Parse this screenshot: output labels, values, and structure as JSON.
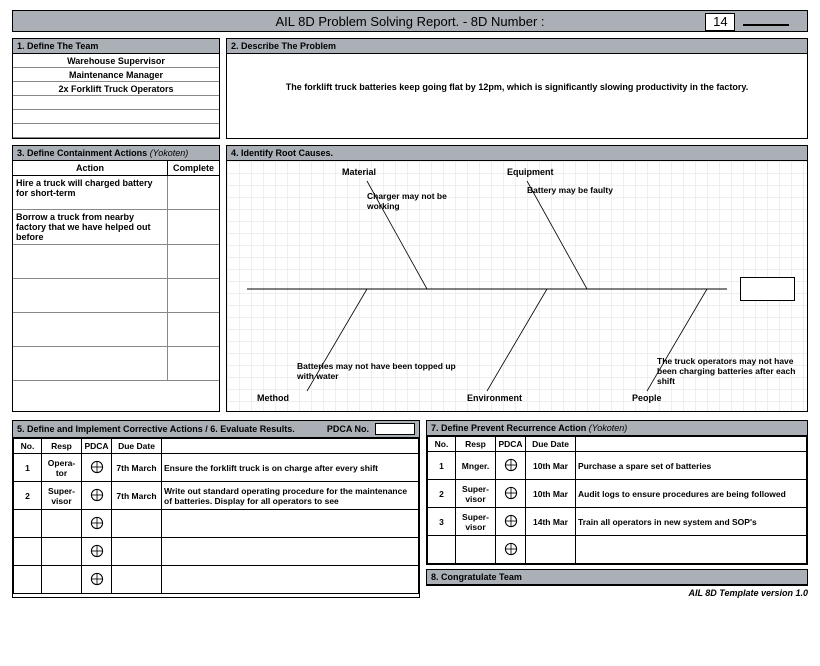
{
  "title": "AIL 8D Problem Solving Report.  -  8D Number :",
  "report_number": "14",
  "sections": {
    "s1": {
      "heading": "1. Define The Team"
    },
    "s2": {
      "heading": "2. Describe The Problem"
    },
    "s3": {
      "heading": "3. Define Containment Actions ",
      "heading_ital": "(Yokoten)"
    },
    "s4": {
      "heading": "4. Identify Root Causes."
    },
    "s5": {
      "heading": "5. Define and Implement Corrective Actions /  6. Evaluate Results."
    },
    "s7": {
      "heading": "7. Define Prevent Recurrence Action ",
      "heading_ital": "(Yokoten)"
    },
    "s8": {
      "heading": "8. Congratulate Team"
    }
  },
  "team": [
    "Warehouse Supervisor",
    "Maintenance Manager",
    "2x Forklift Truck Operators",
    "",
    "",
    ""
  ],
  "problem_description": "The forklift truck batteries keep going flat by 12pm, which is significantly slowing productivity in the factory.",
  "containment": {
    "cols": {
      "action": "Action",
      "complete": "Complete"
    },
    "rows": [
      {
        "action": "Hire a truck will charged battery for short-term",
        "complete": ""
      },
      {
        "action": "Borrow a truck from nearby factory that we have helped out before",
        "complete": ""
      },
      {
        "action": "",
        "complete": ""
      },
      {
        "action": "",
        "complete": ""
      },
      {
        "action": "",
        "complete": ""
      },
      {
        "action": "",
        "complete": ""
      }
    ]
  },
  "fishbone": {
    "categories": {
      "material": "Material",
      "equipment": "Equipment",
      "method": "Method",
      "environment": "Environment",
      "people": "People"
    },
    "causes": {
      "material": "Charger may not be working",
      "equipment": "Battery may be faulty",
      "method": "Batteries may not have been topped up with water",
      "environment": "",
      "people": "The truck operators may not have been charging batteries after each shift"
    }
  },
  "corrective": {
    "pdca_label": "PDCA No.",
    "cols": {
      "no": "No.",
      "resp": "Resp",
      "pdca": "PDCA",
      "due": "Due Date"
    },
    "rows": [
      {
        "no": "1",
        "resp": "Opera-tor",
        "due": "7th March",
        "desc": "Ensure the forklift truck is on charge after every shift"
      },
      {
        "no": "2",
        "resp": "Super-visor",
        "due": "7th March",
        "desc": "Write out standard operating procedure for the maintenance of batteries.  Display for all operators to see"
      },
      {
        "no": "",
        "resp": "",
        "due": "",
        "desc": ""
      },
      {
        "no": "",
        "resp": "",
        "due": "",
        "desc": ""
      },
      {
        "no": "",
        "resp": "",
        "due": "",
        "desc": ""
      }
    ]
  },
  "prevent": {
    "cols": {
      "no": "No.",
      "resp": "Resp",
      "pdca": "PDCA",
      "due": "Due Date"
    },
    "rows": [
      {
        "no": "1",
        "resp": "Mnger.",
        "due": "10th Mar",
        "desc": "Purchase a spare set of batteries"
      },
      {
        "no": "2",
        "resp": "Super-visor",
        "due": "10th Mar",
        "desc": "Audit logs to ensure procedures are being followed"
      },
      {
        "no": "3",
        "resp": "Super-visor",
        "due": "14th Mar",
        "desc": "Train all operators in new system and SOP's"
      },
      {
        "no": "",
        "resp": "",
        "due": "",
        "desc": ""
      }
    ]
  },
  "footer": "AIL 8D Template version 1.0"
}
